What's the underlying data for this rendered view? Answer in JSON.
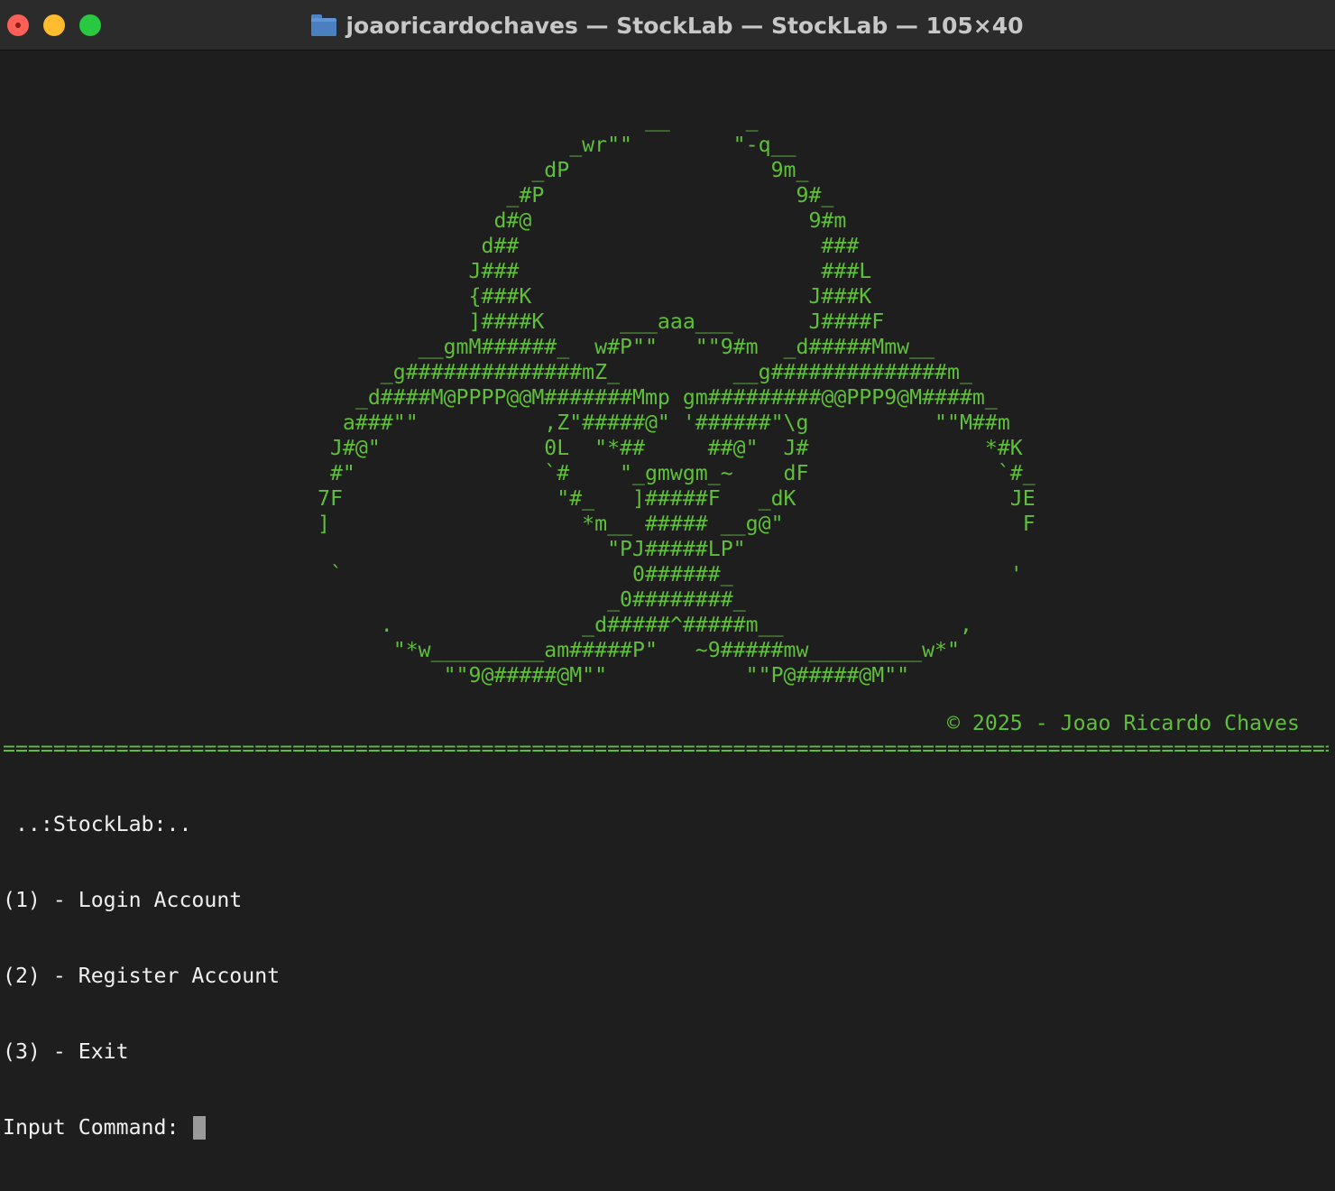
{
  "window": {
    "title": "joaoricardochaves — StockLab — StockLab — 105×40"
  },
  "terminal": {
    "art": "                                                   __      _\n                                             _wr\"\"        \"-q__\n                                          _dP                9m_\n                                        _#P                    9#_\n                                       d#@                      9#m\n                                      d##                        ###\n                                     J###                        ###L\n                                     {###K                      J###K\n                                     ]####K      ___aaa___      J####F\n                                 __gmM######_  w#P\"\"   \"\"9#m  _d#####Mmw__\n                              _g##############mZ_         __g##############m_\n                            _d####M@PPPP@@M#######Mmp gm#########@@PPP9@M####m_\n                           a###\"\"          ,Z\"#####@\" '######\"\\g          \"\"M##m\n                          J#@\"             0L  \"*##     ##@\"  J#              *#K\n                          #\"               `#    \"_gmwgm_~    dF               `#_\n                         7F                 \"#_   ]#####F   _dK                 JE\n                         ]                    *m__ ##### __g@\"                   F\n                                                \"PJ#####LP\"\n                          `                       0######_                      '\n                                                _0########_\n                              .               _d#####^#####m__              ,\n                               \"*w_________am#####P\"   ~9#####mw_________w*\"\n                                   \"\"9@#####@M\"\"           \"\"P@#####@M\"\"",
    "copyright": "© 2025 - Joao Ricardo Chaves",
    "separator": "=====================================================================================================================================",
    "menu": {
      "heading": " ..:StockLab:..",
      "option1": "(1) - Login Account",
      "option2": "(2) - Register Account",
      "option3": "(3) - Exit",
      "prompt": "Input Command: "
    }
  },
  "colors": {
    "background": "#1e1e1e",
    "accent_green": "#5fbf3a",
    "text": "#f0f0f0"
  }
}
